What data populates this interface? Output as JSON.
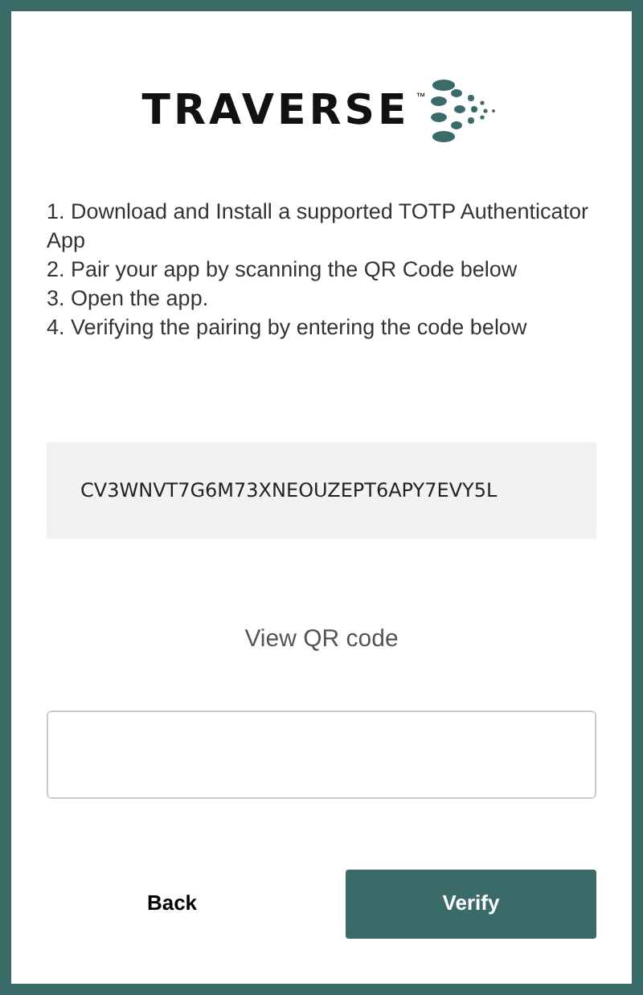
{
  "logo": {
    "text": "TRAVERSE",
    "mark": "™"
  },
  "instructions": [
    "1. Download and Install a supported TOTP Authenticator App",
    "2. Pair your app by scanning the QR Code below",
    "3. Open the app.",
    "4. Verifying the pairing by entering the code below"
  ],
  "secret_key": "CV3WNVT7G6M73XNEOUZEPT6APY7EVY5L",
  "view_qr_link": "View QR code",
  "buttons": [
    {
      "label": "Back",
      "kind": "secondary"
    },
    {
      "label": "Verify",
      "kind": "primary"
    }
  ]
}
